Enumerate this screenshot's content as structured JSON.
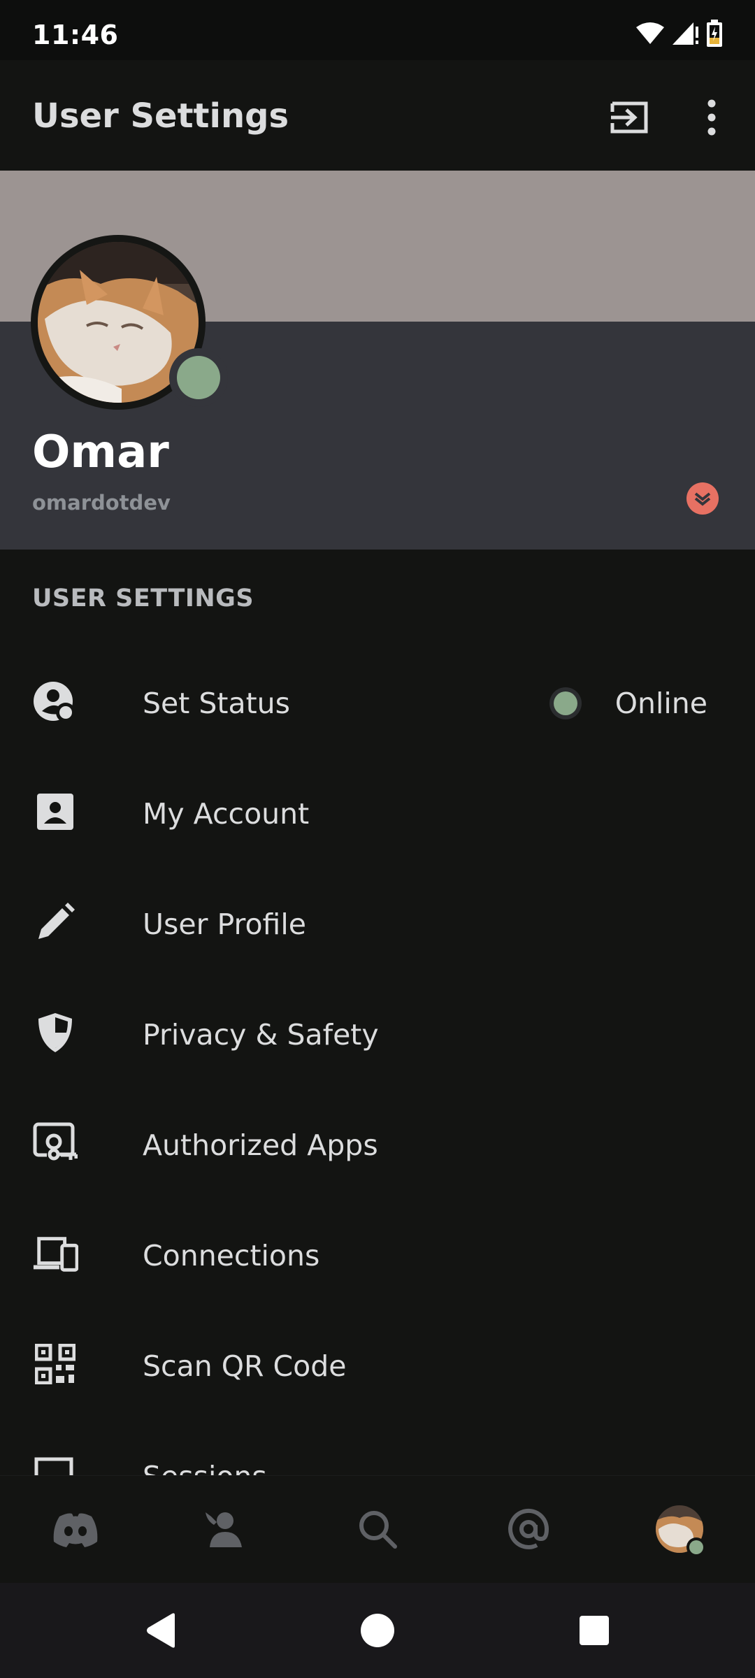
{
  "status_bar": {
    "time": "11:46"
  },
  "app_bar": {
    "title": "User Settings"
  },
  "profile": {
    "display_name": "Omar",
    "username": "omardotdev",
    "status": "online"
  },
  "section_header": "USER SETTINGS",
  "settings": {
    "items": [
      {
        "label": "Set Status",
        "icon": "set-status-icon",
        "value": "Online"
      },
      {
        "label": "My Account",
        "icon": "account-card-icon"
      },
      {
        "label": "User Profile",
        "icon": "pencil-icon"
      },
      {
        "label": "Privacy & Safety",
        "icon": "shield-icon"
      },
      {
        "label": "Authorized Apps",
        "icon": "authorized-apps-icon"
      },
      {
        "label": "Connections",
        "icon": "devices-icon"
      },
      {
        "label": "Scan QR Code",
        "icon": "qr-code-icon"
      },
      {
        "label": "Sessions",
        "icon": "sessions-icon"
      }
    ]
  },
  "bottom_nav": [
    "home-icon",
    "friends-icon",
    "search-icon",
    "mentions-icon",
    "profile-avatar"
  ],
  "colors": {
    "online": "#8aa98a",
    "nitro": "#e77163",
    "banner": "#9c9492",
    "card": "#34353b"
  }
}
